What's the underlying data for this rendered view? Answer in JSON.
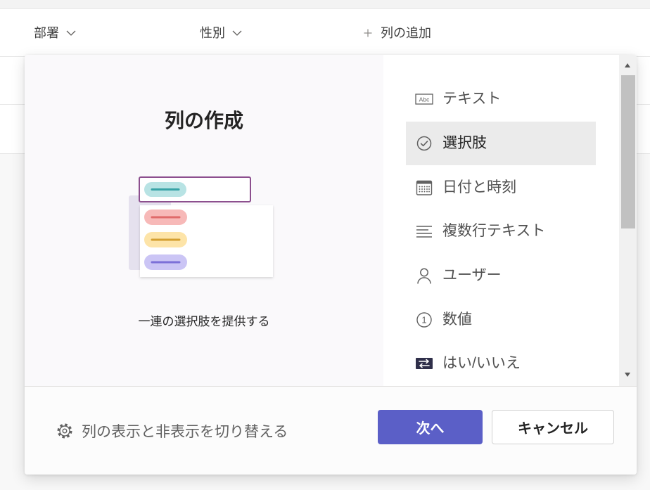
{
  "header": {
    "columns": [
      {
        "label": "部署",
        "icon": "chevron-down-icon"
      },
      {
        "label": "性別",
        "icon": "chevron-down-icon"
      }
    ],
    "add_column": {
      "label": "列の追加",
      "icon": "plus-icon"
    }
  },
  "dialog": {
    "preview": {
      "title": "列の作成",
      "description": "一連の選択肢を提供する"
    },
    "column_types": [
      {
        "label": "テキスト",
        "icon": "text-icon",
        "icon_text": "Abc",
        "selected": false
      },
      {
        "label": "選択肢",
        "icon": "check-circle-icon",
        "selected": true
      },
      {
        "label": "日付と時刻",
        "icon": "calendar-icon",
        "selected": false
      },
      {
        "label": "複数行テキスト",
        "icon": "multiline-text-icon",
        "selected": false
      },
      {
        "label": "ユーザー",
        "icon": "person-icon",
        "selected": false
      },
      {
        "label": "数値",
        "icon": "number-icon",
        "icon_text": "1",
        "selected": false
      },
      {
        "label": "はい/いいえ",
        "icon": "yes-no-toggle-icon",
        "selected": false
      }
    ],
    "footer": {
      "toggle_columns": {
        "label": "列の表示と非表示を切り替える",
        "icon": "gear-icon"
      },
      "next_label": "次へ",
      "cancel_label": "キャンセル"
    }
  },
  "colors": {
    "accent": "#5b5fc7",
    "selected_item_bg": "#ebebeb",
    "preview_panel_bg": "#faf9fb",
    "dropdown_border": "#8c4f8e"
  }
}
